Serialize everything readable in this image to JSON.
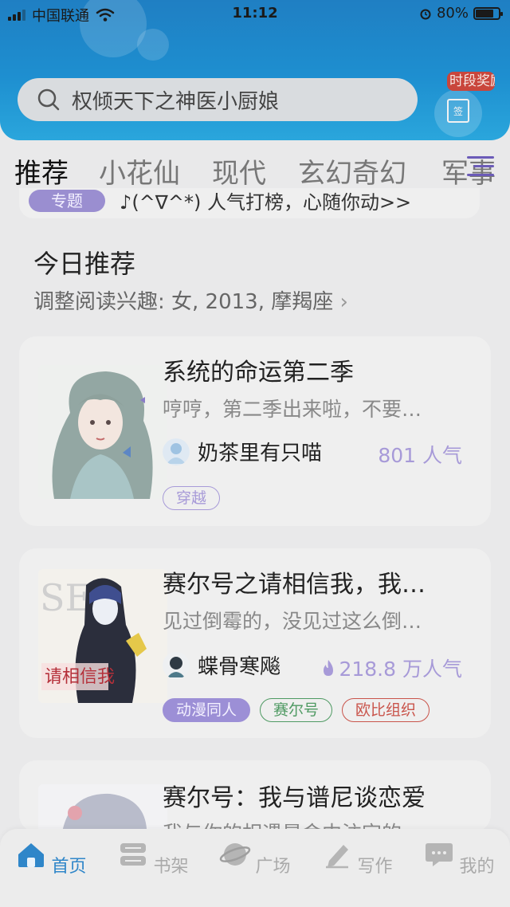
{
  "status_bar": {
    "carrier": "中国联通",
    "time": "11:12",
    "battery": "80%",
    "battery_level": 0.8
  },
  "search": {
    "placeholder": "权倾天下之神医小厨娘"
  },
  "gift": {
    "tag_text": "时段奖励",
    "box_label": "签"
  },
  "tabs": [
    {
      "label": "推荐",
      "active": true
    },
    {
      "label": "小花仙"
    },
    {
      "label": "现代"
    },
    {
      "label": "玄幻奇幻"
    },
    {
      "label": "军事"
    }
  ],
  "banner": {
    "tag": "专题",
    "text": "♪(^∇^*) 人气打榜，心随你动>>"
  },
  "today": {
    "title": "今日推荐",
    "subtitle": "调整阅读兴趣: 女, 2013, 摩羯座"
  },
  "books": [
    {
      "title": "系统的命运第二季",
      "desc": "哼哼，第二季出来啦，不要…",
      "author": "奶茶里有只喵",
      "popularity": "801 人气",
      "hot": false,
      "tags": [
        {
          "label": "穿越",
          "color": "#a79ad8"
        }
      ]
    },
    {
      "title": "赛尔号之请相信我，我…",
      "desc": "见过倒霉的，没见过这么倒…",
      "author": "蝶骨寒飚",
      "popularity": "218.8 万人气",
      "hot": true,
      "tags": [
        {
          "label": "动漫同人",
          "color": "#8c7fd0",
          "filled": true
        },
        {
          "label": "赛尔号",
          "color": "#4f9a63"
        },
        {
          "label": "欧比组织",
          "color": "#c9544b"
        }
      ]
    },
    {
      "title": "赛尔号：我与谱尼谈恋爱",
      "desc": "我与你的相遇是命中注定的",
      "author": "",
      "popularity": "",
      "tags": []
    }
  ],
  "bottom_nav": [
    {
      "label": "首页",
      "icon": "home-icon",
      "active": true
    },
    {
      "label": "书架",
      "icon": "bookshelf-icon"
    },
    {
      "label": "广场",
      "icon": "planet-icon"
    },
    {
      "label": "写作",
      "icon": "pen-icon"
    },
    {
      "label": "我的",
      "icon": "chat-bubble-icon"
    }
  ],
  "colors": {
    "header": "#1e8fd0",
    "accent": "#a79ad8",
    "nav_active": "#2f86c9"
  }
}
